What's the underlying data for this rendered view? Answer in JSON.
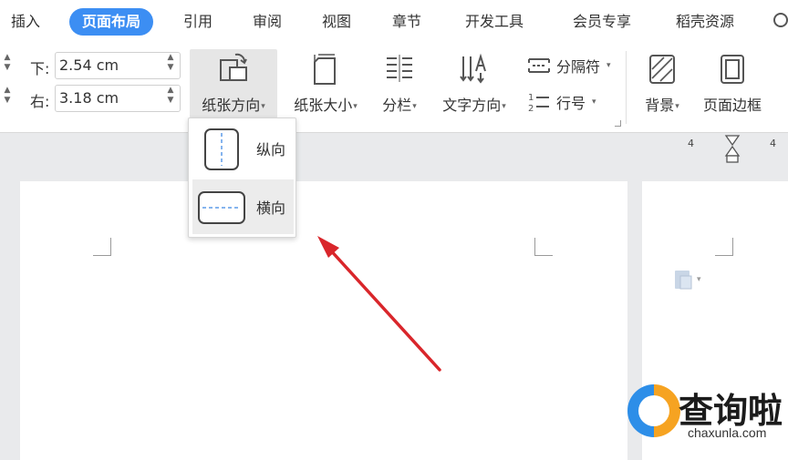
{
  "tabs": [
    {
      "label": "插入"
    },
    {
      "label": "页面布局",
      "active": true
    },
    {
      "label": "引用"
    },
    {
      "label": "审阅"
    },
    {
      "label": "视图"
    },
    {
      "label": "章节"
    },
    {
      "label": "开发工具"
    },
    {
      "label": "会员专享"
    },
    {
      "label": "稻壳资源"
    }
  ],
  "margins": {
    "bottom_label": "下:",
    "bottom_value": "2.54 cm",
    "right_label": "右:",
    "right_value": "3.18 cm"
  },
  "ribbon": {
    "orientation_label": "纸张方向",
    "size_label": "纸张大小",
    "columns_label": "分栏",
    "text_direction_label": "文字方向",
    "separator_label": "分隔符",
    "line_number_label": "行号",
    "background_label": "背景",
    "page_border_label": "页面边框"
  },
  "orientation_menu": {
    "portrait_label": "纵向",
    "landscape_label": "横向"
  },
  "ruler": {
    "left_num": "4",
    "right_num": "4"
  },
  "watermark": {
    "title": "查询啦",
    "url": "chaxunla.com"
  },
  "colors": {
    "accent": "#3c8ef3",
    "arrow": "#d9262b",
    "workspace": "#e9eaec"
  }
}
